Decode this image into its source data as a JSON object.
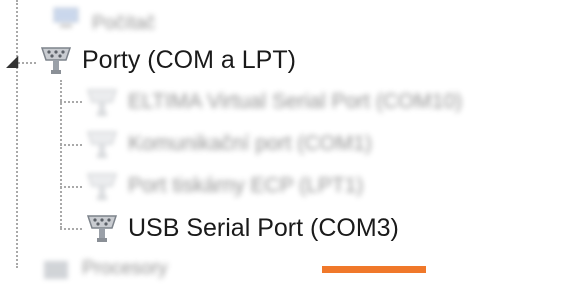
{
  "tree": {
    "top_item": {
      "label": "Počítač",
      "icon": "computer-icon"
    },
    "category": {
      "label": "Porty (COM a LPT)",
      "icon": "port-connector-icon",
      "expanded": true,
      "expander_glyph": "◢"
    },
    "children": [
      {
        "label": "ELTIMA Virtual Serial Port (COM10)",
        "icon": "port-connector-icon"
      },
      {
        "label": "Komunikační port (COM1)",
        "icon": "port-connector-icon"
      },
      {
        "label": "Port tiskárny ECP (LPT1)",
        "icon": "port-connector-icon"
      },
      {
        "label": "USB Serial Port (COM3)",
        "icon": "port-connector-icon"
      }
    ],
    "bottom_item": {
      "label": "Procesory",
      "icon": "processor-icon"
    }
  },
  "colors": {
    "accent": "#f0782a",
    "tree_lines": "#a9a9a9",
    "icon": "#8a8f96"
  }
}
